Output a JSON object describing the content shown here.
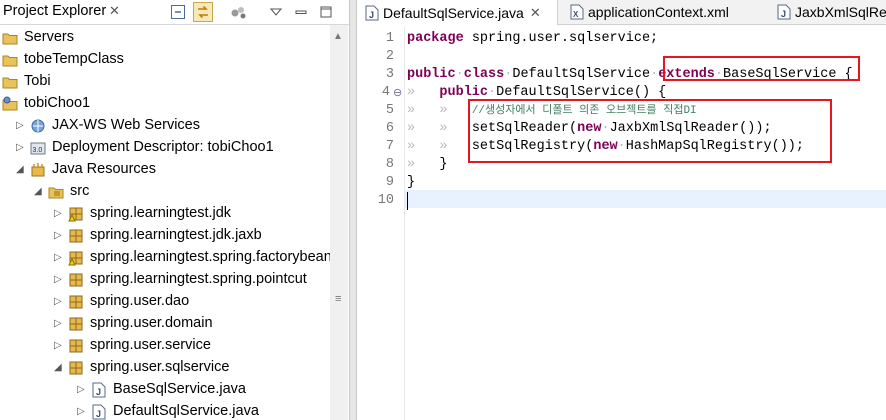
{
  "explorer": {
    "title": "Project Explorer",
    "close": "✕",
    "items": [
      {
        "label": "Servers",
        "icon": "folder-icon",
        "indent": 0,
        "twisty": ""
      },
      {
        "label": "tobeTempClass",
        "icon": "folder-icon",
        "indent": 0,
        "twisty": ""
      },
      {
        "label": "Tobi",
        "icon": "folder-icon",
        "indent": 0,
        "twisty": ""
      },
      {
        "label": "tobiChoo1",
        "icon": "web-project-icon",
        "indent": 0,
        "twisty": ""
      },
      {
        "label": "JAX-WS Web Services",
        "icon": "web-services-icon",
        "indent": 1,
        "twisty": "▷"
      },
      {
        "label": "Deployment Descriptor: tobiChoo1",
        "icon": "deployment-descriptor-icon",
        "indent": 1,
        "twisty": "▷"
      },
      {
        "label": "Java Resources",
        "icon": "java-resources-icon",
        "indent": 1,
        "twisty": "◢"
      },
      {
        "label": "src",
        "icon": "source-folder-icon",
        "indent": 2,
        "twisty": "◢"
      },
      {
        "label": "spring.learningtest.jdk",
        "icon": "package-warning-icon",
        "indent": 3,
        "twisty": "▷"
      },
      {
        "label": "spring.learningtest.jdk.jaxb",
        "icon": "package-icon",
        "indent": 3,
        "twisty": "▷"
      },
      {
        "label": "spring.learningtest.spring.factorybean",
        "icon": "package-warning-icon",
        "indent": 3,
        "twisty": "▷"
      },
      {
        "label": "spring.learningtest.spring.pointcut",
        "icon": "package-icon",
        "indent": 3,
        "twisty": "▷"
      },
      {
        "label": "spring.user.dao",
        "icon": "package-icon",
        "indent": 3,
        "twisty": "▷"
      },
      {
        "label": "spring.user.domain",
        "icon": "package-icon",
        "indent": 3,
        "twisty": "▷"
      },
      {
        "label": "spring.user.service",
        "icon": "package-icon",
        "indent": 3,
        "twisty": "▷"
      },
      {
        "label": "spring.user.sqlservice",
        "icon": "package-icon",
        "indent": 3,
        "twisty": "◢"
      },
      {
        "label": "BaseSqlService.java",
        "icon": "java-file-icon",
        "indent": 4,
        "twisty": "▷"
      },
      {
        "label": "DefaultSqlService.java",
        "icon": "java-file-icon",
        "indent": 4,
        "twisty": "▷"
      }
    ]
  },
  "editor": {
    "tabs": [
      {
        "label": "DefaultSqlService.java",
        "close": "✕",
        "icon": "java-file-icon",
        "active": true
      },
      {
        "label": "applicationContext.xml",
        "icon": "xml-file-icon",
        "active": false
      },
      {
        "label": "JaxbXmlSqlRe",
        "icon": "java-file-icon",
        "active": false
      }
    ],
    "line_numbers": [
      "1",
      "2",
      "3",
      "4",
      "5",
      "6",
      "7",
      "8",
      "9",
      "10"
    ],
    "override_marker": "⊖",
    "code": {
      "l1_kw": "package",
      "l1_rest": " spring.user.sqlservice;",
      "l3_kw1": "public",
      "l3_kw2": "class",
      "l3_name": "DefaultSqlService",
      "l3_kw3": "extends",
      "l3_base": "BaseSqlService",
      "l3_brace": " {",
      "l4_kw": "public",
      "l4_rest": "DefaultSqlService() {",
      "l5_comment": "//생성자에서 디폴트 의존 오브젝트를 직접DI",
      "l6": "setSqlReader(",
      "l6_kw": "new",
      "l6_rest": "JaxbXmlSqlReader());",
      "l7": "setSqlRegistry(",
      "l7_kw": "new",
      "l7_rest": "HashMapSqlRegistry());",
      "l8": "}",
      "l9": "}"
    }
  }
}
